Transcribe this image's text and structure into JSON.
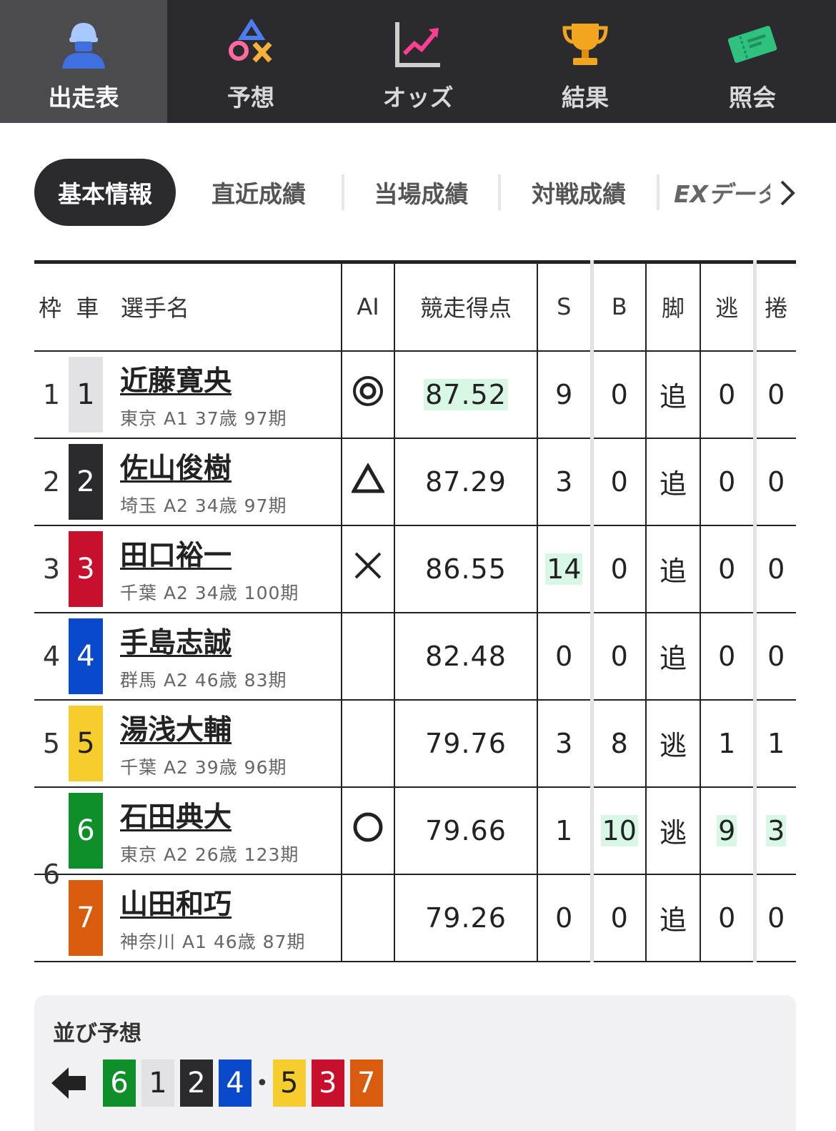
{
  "nav": {
    "items": [
      {
        "label": "出走表",
        "icon": "rider-icon",
        "active": true
      },
      {
        "label": "予想",
        "icon": "prediction-marks-icon",
        "active": false
      },
      {
        "label": "オッズ",
        "icon": "odds-chart-icon",
        "active": false
      },
      {
        "label": "結果",
        "icon": "trophy-icon",
        "active": false
      },
      {
        "label": "照会",
        "icon": "ticket-icon",
        "active": false
      }
    ]
  },
  "subtabs": {
    "items": [
      "基本情報",
      "直近成績",
      "当場成績",
      "対戦成績",
      "EXデータ"
    ],
    "active_index": 0
  },
  "table": {
    "headers": {
      "waku": "枠",
      "car": "車",
      "name": "選手名",
      "ai": "AI",
      "score": "競走得点",
      "s": "S",
      "b": "B",
      "leg": "脚",
      "nige": "逃",
      "makuri": "捲"
    },
    "rows": [
      {
        "waku": "1",
        "car": "1",
        "name": "近藤寛央",
        "meta": "東京 A1 37歳 97期",
        "ai": "◎",
        "ai_icon": "double-circle-icon",
        "score": "87.52",
        "s": "9",
        "b": "0",
        "leg": "追",
        "nige": "0",
        "makuri": "0"
      },
      {
        "waku": "2",
        "car": "2",
        "name": "佐山俊樹",
        "meta": "埼玉 A2 34歳 97期",
        "ai": "△",
        "ai_icon": "triangle-icon",
        "score": "87.29",
        "s": "3",
        "b": "0",
        "leg": "追",
        "nige": "0",
        "makuri": "0"
      },
      {
        "waku": "3",
        "car": "3",
        "name": "田口裕一",
        "meta": "千葉 A2 34歳 100期",
        "ai": "×",
        "ai_icon": "cross-icon",
        "score": "86.55",
        "s": "14",
        "b": "0",
        "leg": "追",
        "nige": "0",
        "makuri": "0"
      },
      {
        "waku": "4",
        "car": "4",
        "name": "手島志誠",
        "meta": "群馬 A2 46歳 83期",
        "ai": "",
        "ai_icon": "",
        "score": "82.48",
        "s": "0",
        "b": "0",
        "leg": "追",
        "nige": "0",
        "makuri": "0"
      },
      {
        "waku": "5",
        "car": "5",
        "name": "湯浅大輔",
        "meta": "千葉 A2 39歳 96期",
        "ai": "",
        "ai_icon": "",
        "score": "79.76",
        "s": "3",
        "b": "8",
        "leg": "逃",
        "nige": "1",
        "makuri": "1"
      },
      {
        "waku": "6",
        "car": "6",
        "name": "石田典大",
        "meta": "東京 A2 26歳 123期",
        "ai": "○",
        "ai_icon": "circle-icon",
        "score": "79.66",
        "s": "1",
        "b": "10",
        "leg": "逃",
        "nige": "9",
        "makuri": "3"
      },
      {
        "waku": "",
        "car": "7",
        "name": "山田和巧",
        "meta": "神奈川 A1 46歳 87期",
        "ai": "",
        "ai_icon": "",
        "score": "79.26",
        "s": "0",
        "b": "0",
        "leg": "追",
        "nige": "0",
        "makuri": "0"
      }
    ]
  },
  "line_prediction": {
    "title": "並び予想",
    "order": [
      "6",
      "1",
      "2",
      "4",
      "5",
      "3",
      "7"
    ],
    "separator": "•"
  },
  "colors": {
    "car_1": "#e2e2e4",
    "car_2": "#2a2a2f",
    "car_3": "#c8102e",
    "car_4": "#0a49c9",
    "car_5": "#f7cd2e",
    "car_6": "#0e8f2a",
    "car_7": "#d95b0e",
    "highlight": "#d8f7e4",
    "nav_bg": "#2a2a2f"
  }
}
